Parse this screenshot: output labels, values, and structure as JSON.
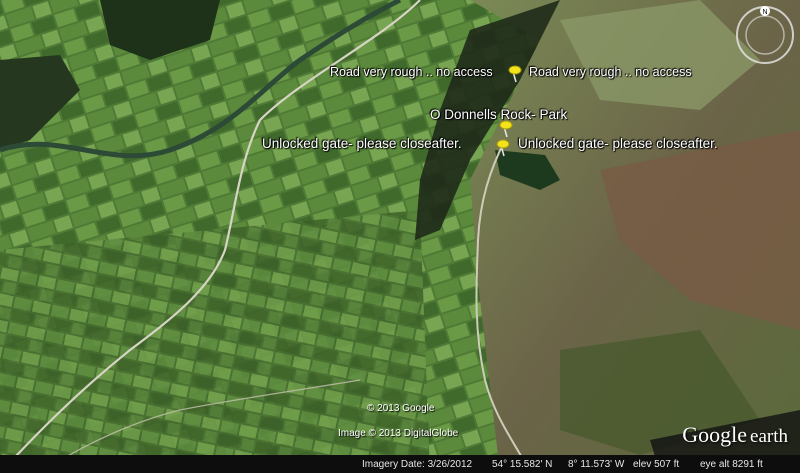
{
  "placemarks": [
    {
      "label": "Road very rough .. no access",
      "side": "left"
    },
    {
      "label": "Road very rough .. no access",
      "side": "right"
    },
    {
      "label": "O Donnells Rock- Park"
    },
    {
      "label": "Unlocked gate- please closeafter.",
      "side": "left"
    },
    {
      "label": "Unlocked gate- please closeafter.",
      "side": "right"
    }
  ],
  "copyright": {
    "google": "© 2013 Google",
    "digitalglobe": "Image © 2013 DigitalGlobe"
  },
  "status": {
    "imagery_date": "Imagery Date: 3/26/2012",
    "lat": "54° 15.582' N",
    "lon": "8° 11.573' W",
    "elev": "elev  507 ft",
    "eye_alt": "eye alt  8291 ft"
  },
  "logo": {
    "google": "Google",
    "earth": "earth"
  },
  "compass": {
    "north": "N"
  },
  "colors": {
    "pin": "#f3e31a",
    "status_bg": "#0d0d0d"
  }
}
